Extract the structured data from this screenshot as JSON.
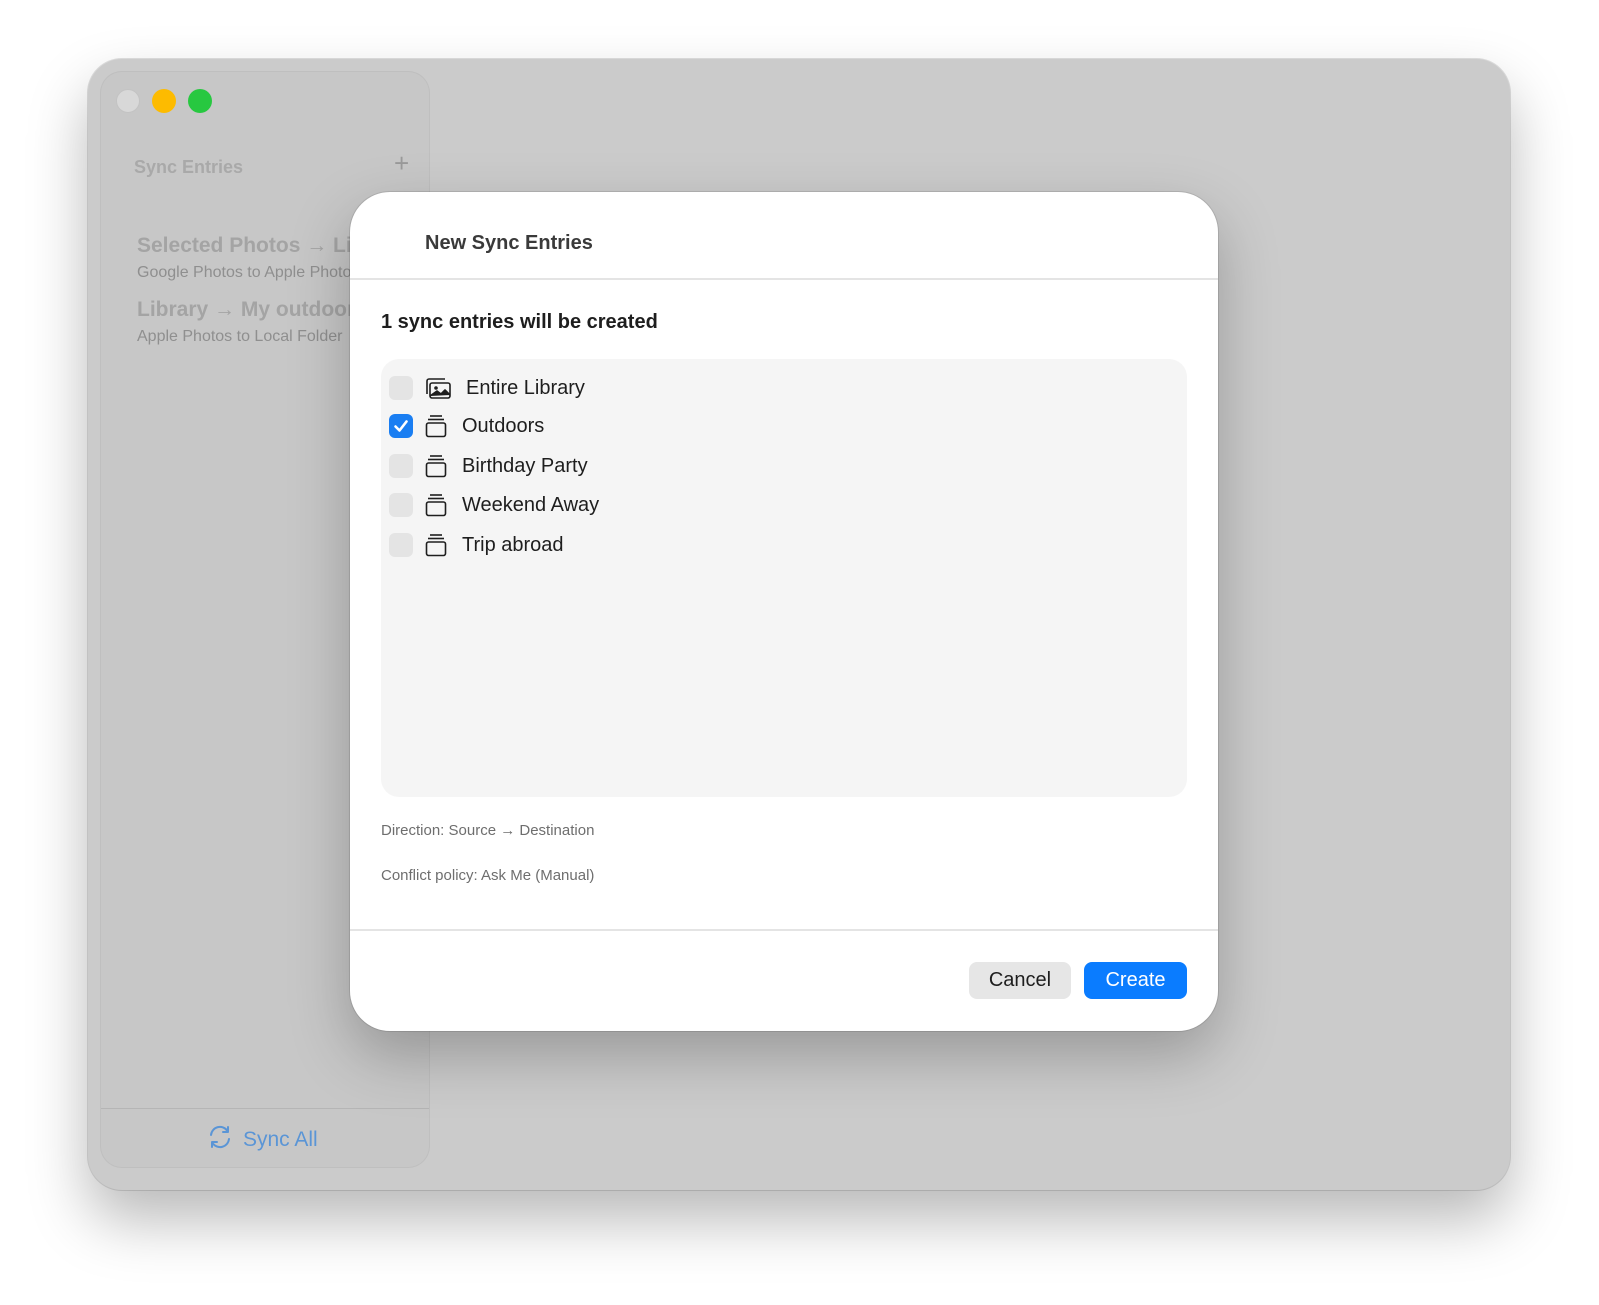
{
  "sidebar": {
    "header": "Sync Entries",
    "add_label": "+",
    "entries": [
      {
        "title": "Selected Photos → Library",
        "subtitle": "Google Photos to Apple Photos"
      },
      {
        "title": "Library → My outdoor photos",
        "subtitle": "Apple Photos to Local Folder"
      }
    ],
    "sync_all_label": "Sync All"
  },
  "dialog": {
    "title": "New Sync Entries",
    "summary": "1 sync entries will be created",
    "items": [
      {
        "label": "Entire Library",
        "checked": false,
        "icon": "photo-library-icon"
      },
      {
        "label": "Outdoors",
        "checked": true,
        "icon": "album-icon"
      },
      {
        "label": "Birthday Party",
        "checked": false,
        "icon": "album-icon"
      },
      {
        "label": "Weekend Away",
        "checked": false,
        "icon": "album-icon"
      },
      {
        "label": "Trip abroad",
        "checked": false,
        "icon": "album-icon"
      }
    ],
    "direction": "Direction: Source → Destination",
    "conflict_policy": "Conflict policy: Ask Me (Manual)",
    "cancel_label": "Cancel",
    "create_label": "Create"
  },
  "colors": {
    "accent": "#0a7cff",
    "checkbox_checked": "#1a7ef2",
    "sync_all": "#5a95d6",
    "traffic_close": "#d8d8d8",
    "traffic_min": "#fdbb00",
    "traffic_max": "#27c840"
  }
}
